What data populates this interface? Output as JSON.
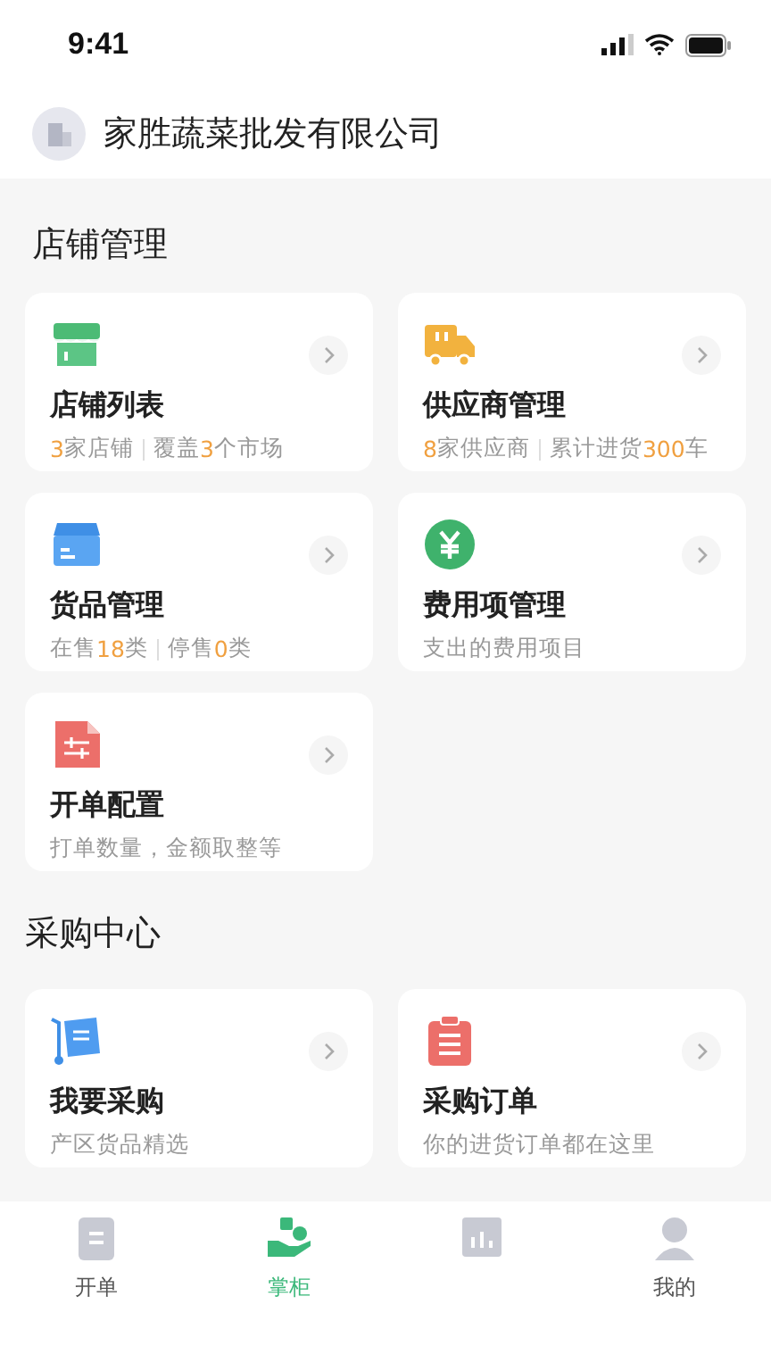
{
  "status_bar": {
    "time": "9:41"
  },
  "header": {
    "company": "家胜蔬菜批发有限公司"
  },
  "sections": [
    {
      "title": "店铺管理",
      "cards": [
        {
          "kind": "store",
          "title": "店铺列表",
          "subtitle": [
            [
              {
                "text": "3",
                "highlight": true
              },
              {
                "text": "家店铺",
                "highlight": false
              }
            ],
            [
              {
                "text": "覆盖",
                "highlight": false
              },
              {
                "text": "3",
                "highlight": true
              },
              {
                "text": "个市场",
                "highlight": false
              }
            ]
          ]
        },
        {
          "kind": "truck",
          "title": "供应商管理",
          "subtitle": [
            [
              {
                "text": "8",
                "highlight": true
              },
              {
                "text": "家供应商",
                "highlight": false
              }
            ],
            [
              {
                "text": "累计进货",
                "highlight": false
              },
              {
                "text": "300",
                "highlight": true
              },
              {
                "text": "车",
                "highlight": false
              }
            ]
          ]
        },
        {
          "kind": "box",
          "title": "货品管理",
          "subtitle": [
            [
              {
                "text": "在售",
                "highlight": false
              },
              {
                "text": "18",
                "highlight": true
              },
              {
                "text": "类",
                "highlight": false
              }
            ],
            [
              {
                "text": "停售",
                "highlight": false
              },
              {
                "text": "0",
                "highlight": true
              },
              {
                "text": "类",
                "highlight": false
              }
            ]
          ]
        },
        {
          "kind": "yen",
          "title": "费用项管理",
          "subtitle": [
            [
              {
                "text": "支出的费用项目",
                "highlight": false
              }
            ]
          ]
        },
        {
          "kind": "sliders",
          "title": "开单配置",
          "subtitle": [
            [
              {
                "text": "打单数量，金额取整等",
                "highlight": false
              }
            ]
          ]
        }
      ]
    },
    {
      "title": "采购中心",
      "cards": [
        {
          "kind": "cart",
          "title": "我要采购",
          "subtitle": [
            [
              {
                "text": "产区货品精选",
                "highlight": false
              }
            ]
          ]
        },
        {
          "kind": "clipboard",
          "title": "采购订单",
          "subtitle": [
            [
              {
                "text": "你的进货订单都在这里",
                "highlight": false
              }
            ]
          ]
        }
      ]
    }
  ],
  "tab_bar": [
    {
      "kind": "clipboard",
      "label": "开单",
      "selected": false
    },
    {
      "kind": "hand",
      "label": "掌柜",
      "selected": true
    },
    {
      "kind": "chart",
      "selected": false
    },
    {
      "kind": "person",
      "label": "我的",
      "selected": false
    }
  ]
}
